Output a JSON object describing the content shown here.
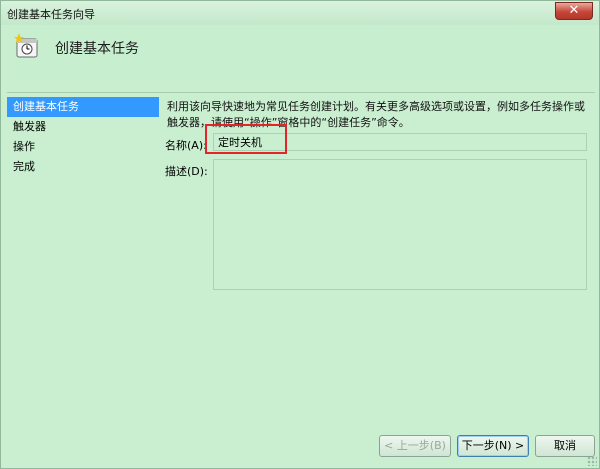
{
  "window": {
    "title": "创建基本任务向导",
    "close_label": "✕"
  },
  "header": {
    "title": "创建基本任务",
    "icon": "task-wizard-clock-icon"
  },
  "nav": {
    "items": [
      {
        "label": "创建基本任务",
        "active": true
      },
      {
        "label": "触发器",
        "active": false
      },
      {
        "label": "操作",
        "active": false
      },
      {
        "label": "完成",
        "active": false
      }
    ]
  },
  "main": {
    "description": "利用该向导快速地为常见任务创建计划。有关更多高级选项或设置，例如多任务操作或触发器，请使用“操作”窗格中的“创建任务”命令。",
    "name_label": "名称(A):",
    "name_value": "定时关机",
    "desc_label": "描述(D):",
    "desc_value": ""
  },
  "buttons": {
    "back": "< 上一步(B)",
    "next": "下一步(N) >",
    "cancel": "取消"
  },
  "colors": {
    "background": "#c9efd0",
    "nav_active": "#3399ff",
    "highlight": "#e4242a"
  }
}
